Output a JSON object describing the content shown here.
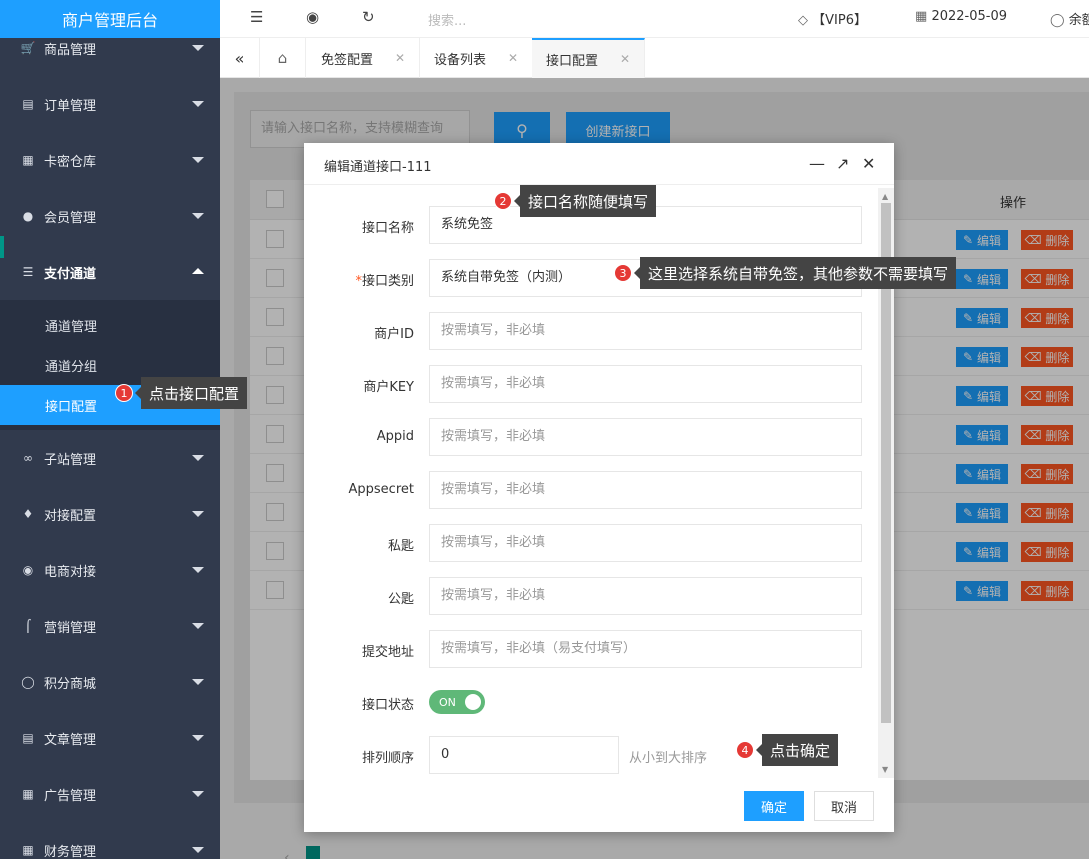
{
  "sidebar": {
    "brand": "商户管理后台",
    "items": [
      {
        "label": "商品管理",
        "icon": "cart-icon"
      },
      {
        "label": "订单管理",
        "icon": "clipboard-icon"
      },
      {
        "label": "卡密仓库",
        "icon": "warehouse-icon"
      },
      {
        "label": "会员管理",
        "icon": "users-icon"
      },
      {
        "label": "支付通道",
        "icon": "list-icon"
      },
      {
        "label": "子站管理",
        "icon": "sitemap-icon"
      },
      {
        "label": "对接配置",
        "icon": "puzzle-icon"
      },
      {
        "label": "电商对接",
        "icon": "shop-bag-icon"
      },
      {
        "label": "营销管理",
        "icon": "share-icon"
      },
      {
        "label": "积分商城",
        "icon": "database-icon"
      },
      {
        "label": "文章管理",
        "icon": "document-icon"
      },
      {
        "label": "广告管理",
        "icon": "calendar-icon"
      },
      {
        "label": "财务管理",
        "icon": "finance-icon"
      }
    ],
    "submenu": [
      "通道管理",
      "通道分组",
      "接口配置"
    ]
  },
  "topbar": {
    "search_placeholder": "搜索...",
    "vip": "【VIP6】",
    "date": "2022-05-09",
    "balance_label": "余额"
  },
  "tabs": [
    "免签配置",
    "设备列表",
    "接口配置"
  ],
  "page": {
    "search_placeholder": "请输入接口名称，支持模糊查询",
    "create_button": "创建新接口",
    "col_operations": "操作",
    "edit_label": "编辑",
    "delete_label": "删除",
    "row_count": 10
  },
  "dialog": {
    "title": "编辑通道接口-111",
    "fields": {
      "name_label": "接口名称",
      "name_value": "系统免签",
      "type_required": "*",
      "type_label": "接口类别",
      "type_value": "系统自带免签（内测）",
      "merchant_id_label": "商户ID",
      "merchant_key_label": "商户KEY",
      "appid_label": "Appid",
      "appsecret_label": "Appsecret",
      "private_key_label": "私匙",
      "public_key_label": "公匙",
      "submit_url_label": "提交地址",
      "optional_placeholder": "按需填写，非必填",
      "submit_url_placeholder": "按需填写，非必填（易支付填写）",
      "status_label": "接口状态",
      "status_value": "ON",
      "sort_label": "排列顺序",
      "sort_value": "0",
      "sort_hint": "从小到大排序"
    },
    "ok_button": "确定",
    "cancel_button": "取消"
  },
  "annotations": [
    {
      "num": "1",
      "text": "点击接口配置"
    },
    {
      "num": "2",
      "text": "接口名称随便填写"
    },
    {
      "num": "3",
      "text": "这里选择系统自带免签，其他参数不需要填写"
    },
    {
      "num": "4",
      "text": "点击确定"
    }
  ],
  "colors": {
    "accent": "#1e9fff",
    "sidebar": "#313a4d",
    "danger": "#ff5722",
    "switch_on": "#5fb878",
    "annotation": "#e53935"
  }
}
